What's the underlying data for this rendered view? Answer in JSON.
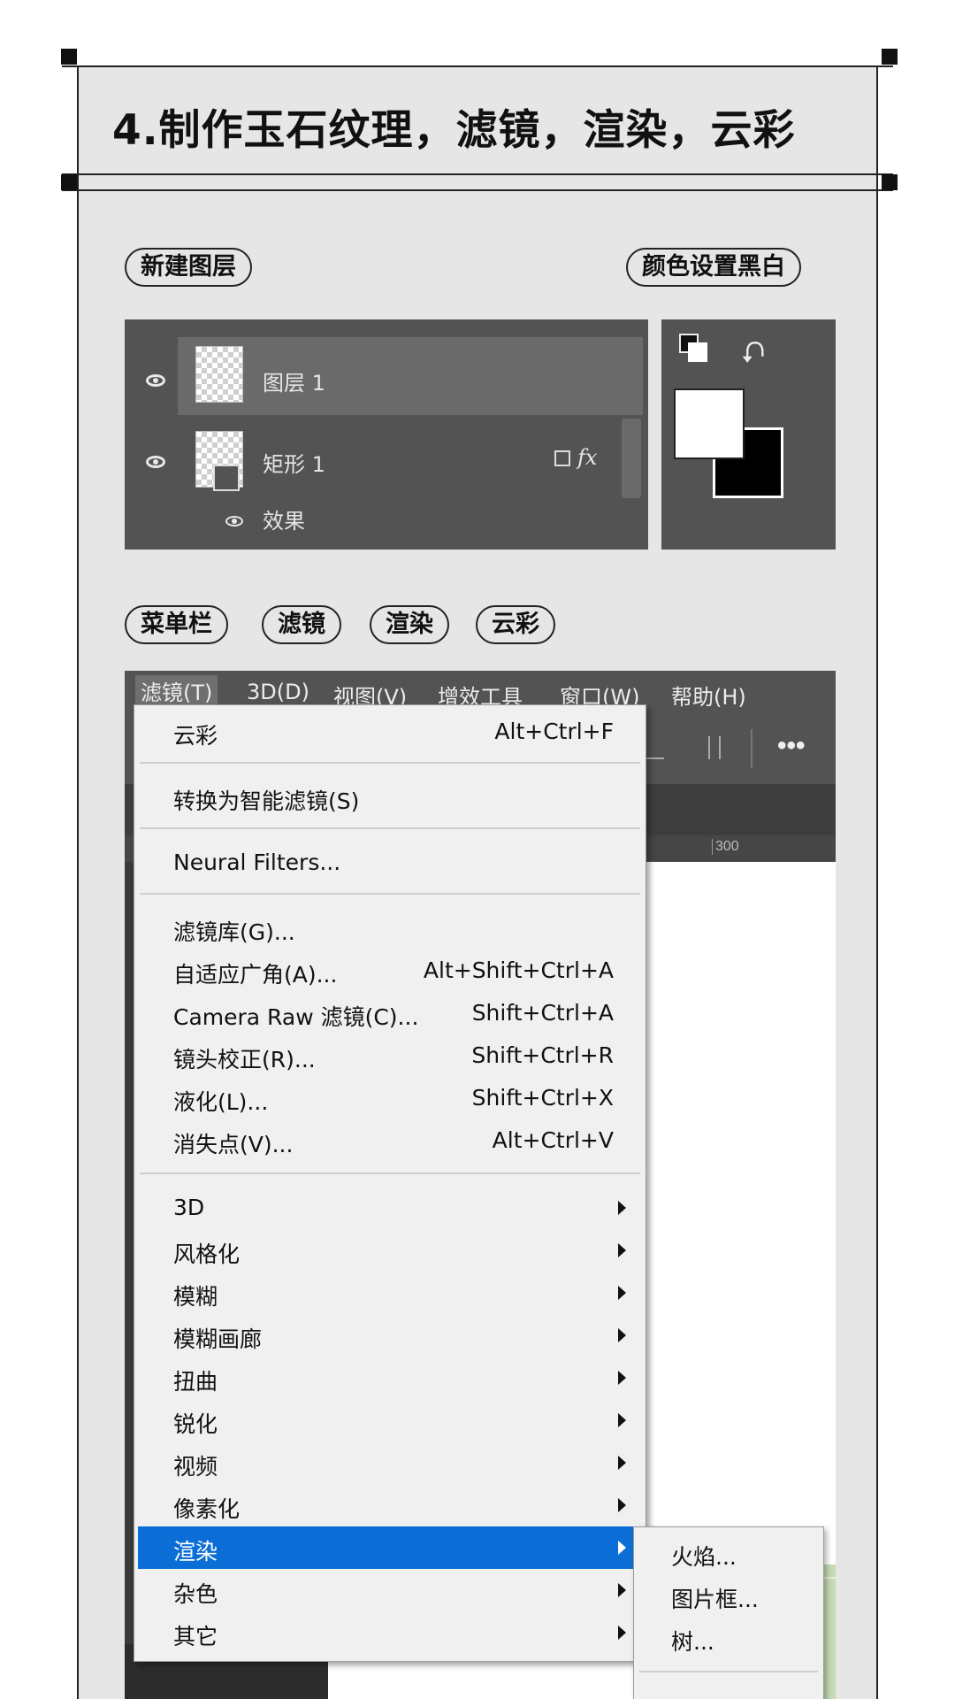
{
  "title": "4.制作玉石纹理，滤镜，渲染，云彩",
  "steps_row1": {
    "left": "新建图层",
    "right": "颜色设置黑白"
  },
  "layers": {
    "layer1": "图层 1",
    "layer2": "矩形 1",
    "fx": "fx",
    "effects": "效果"
  },
  "steps_row2": [
    "菜单栏",
    "滤镜",
    "渲染",
    "云彩"
  ],
  "menubar": [
    "滤镜(T)",
    "3D(D)",
    "视图(V)",
    "增效工具",
    "窗口(W)",
    "帮助(H)"
  ],
  "ruler_mark": "300",
  "filter_menu": {
    "group1": [
      {
        "label": "云彩",
        "shortcut": "Alt+Ctrl+F"
      }
    ],
    "group2": [
      {
        "label": "转换为智能滤镜(S)"
      }
    ],
    "group3": [
      {
        "label": "Neural Filters..."
      }
    ],
    "group4": [
      {
        "label": "滤镜库(G)..."
      },
      {
        "label": "自适应广角(A)...",
        "shortcut": "Alt+Shift+Ctrl+A"
      },
      {
        "label": "Camera Raw 滤镜(C)...",
        "shortcut": "Shift+Ctrl+A"
      },
      {
        "label": "镜头校正(R)...",
        "shortcut": "Shift+Ctrl+R"
      },
      {
        "label": "液化(L)...",
        "shortcut": "Shift+Ctrl+X"
      },
      {
        "label": "消失点(V)...",
        "shortcut": "Alt+Ctrl+V"
      }
    ],
    "group5": [
      "3D",
      "风格化",
      "模糊",
      "模糊画廊",
      "扭曲",
      "锐化",
      "视频",
      "像素化",
      "渲染",
      "杂色",
      "其它"
    ]
  },
  "render_submenu": [
    "火焰...",
    "图片框...",
    "树..."
  ],
  "colors": {
    "highlight": "#0b6ed6",
    "panel": "#e6e6e6",
    "ps_dark": "#535353"
  }
}
